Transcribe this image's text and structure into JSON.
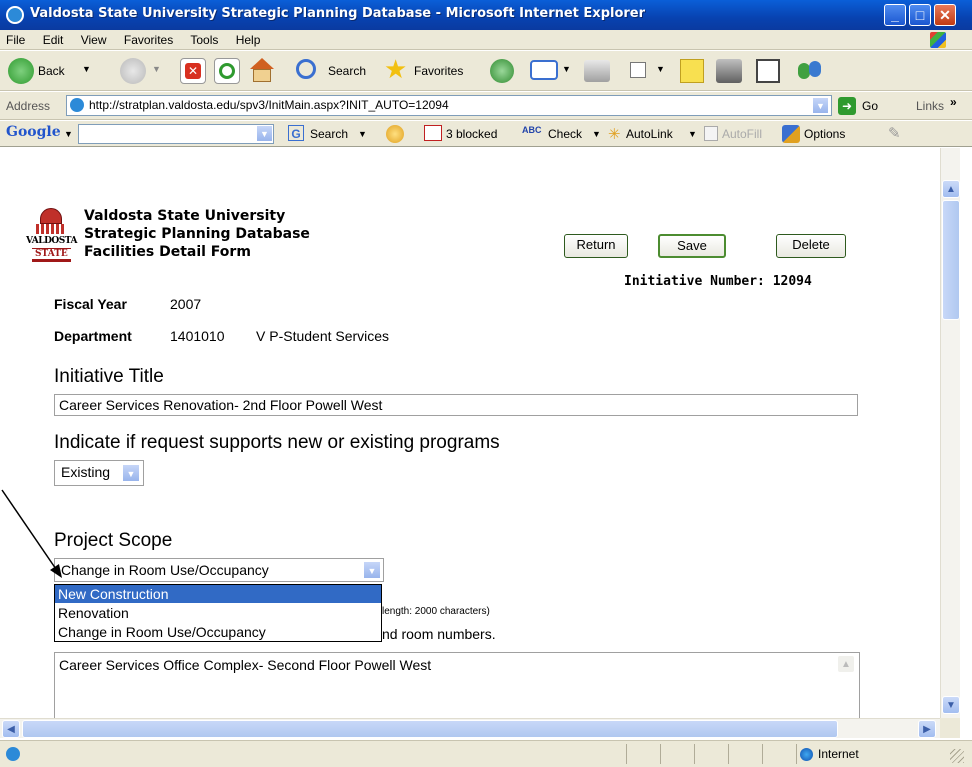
{
  "window": {
    "title": "Valdosta State University Strategic Planning Database - Microsoft Internet Explorer"
  },
  "menu": [
    "File",
    "Edit",
    "View",
    "Favorites",
    "Tools",
    "Help"
  ],
  "toolbar": {
    "back_label": "Back",
    "search_label": "Search",
    "favorites_label": "Favorites"
  },
  "address": {
    "label": "Address",
    "url": "http://stratplan.valdosta.edu/spv3/InitMain.aspx?INIT_AUTO=12094",
    "go_label": "Go",
    "links_label": "Links"
  },
  "googlebar": {
    "logo": "Google",
    "search_label": "Search",
    "blocked_label": "3 blocked",
    "check_label": "Check",
    "autolink_label": "AutoLink",
    "autofill_label": "AutoFill",
    "options_label": "Options"
  },
  "page": {
    "logo_text_1": "VALDOSTA",
    "logo_text_2": "STATE",
    "header_line1": "Valdosta State University",
    "header_line2": "Strategic Planning Database",
    "header_line3": "Facilities Detail Form",
    "return_label": "Return",
    "save_label": "Save",
    "delete_label": "Delete",
    "initiative_number": "Initiative Number: 12094",
    "fiscal_year_label": "Fiscal Year",
    "fiscal_year_value": "2007",
    "department_label": "Department",
    "department_code": "1401010",
    "department_name": "V P-Student Services",
    "initiative_title_heading": "Initiative Title",
    "initiative_title_value": "Career Services Renovation- 2nd Floor Powell West",
    "programs_heading": "Indicate if request supports new or existing programs",
    "programs_value": "Existing",
    "scope_heading": "Project Scope",
    "scope_value": "Change in Room Use/Occupancy",
    "scope_options": [
      "New Construction",
      "Renovation",
      "Change in Room Use/Occupancy"
    ],
    "behind_text_1": "length: 2000 characters)",
    "behind_text_2": "nd room numbers.",
    "description_value": "Career Services Office Complex- Second Floor Powell West"
  },
  "status": {
    "zone": "Internet"
  },
  "colors": {
    "titlebar": "#0842b0",
    "dropdown_highlight": "#316ac5",
    "chrome": "#ece9d8"
  }
}
